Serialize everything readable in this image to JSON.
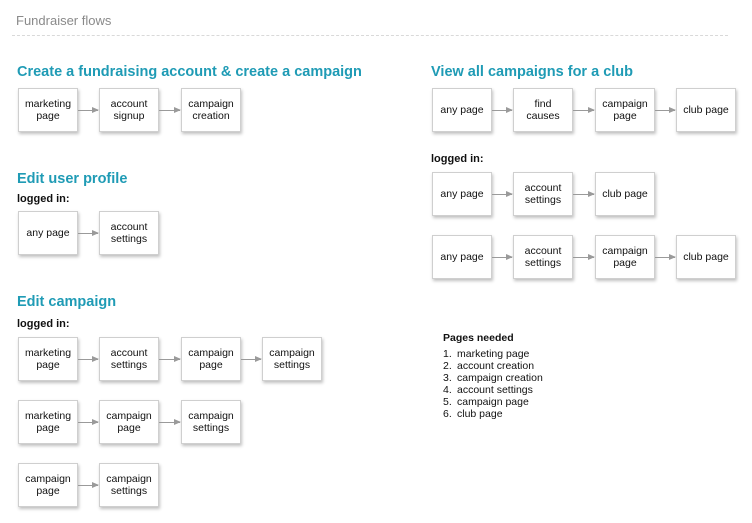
{
  "page_title": "Fundraiser flows",
  "flows": {
    "create_account": {
      "title": "Create a fundraising account & create a campaign",
      "row1": [
        "marketing\npage",
        "account\nsignup",
        "campaign\ncreation"
      ]
    },
    "edit_profile": {
      "title": "Edit user profile",
      "label": "logged in:",
      "row1": [
        "any page",
        "account\nsettings"
      ]
    },
    "edit_campaign": {
      "title": "Edit campaign",
      "label": "logged in:",
      "row1": [
        "marketing\npage",
        "account\nsettings",
        "campaign\npage",
        "campaign\nsettings"
      ],
      "row2": [
        "marketing\npage",
        "campaign\npage",
        "campaign\nsettings"
      ],
      "row3": [
        "campaign\npage",
        "campaign\nsettings"
      ]
    },
    "view_campaigns": {
      "title": "View all campaigns for a club",
      "label": "logged in:",
      "row1": [
        "any page",
        "find\ncauses",
        "campaign\npage",
        "club page"
      ],
      "row2": [
        "any page",
        "account\nsettings",
        "club page"
      ],
      "row3": [
        "any page",
        "account\nsettings",
        "campaign\npage",
        "club page"
      ]
    }
  },
  "pages_needed": {
    "title": "Pages needed",
    "items": [
      "marketing page",
      "account creation",
      "campaign creation",
      "account settings",
      "campaign page",
      "club page"
    ]
  }
}
